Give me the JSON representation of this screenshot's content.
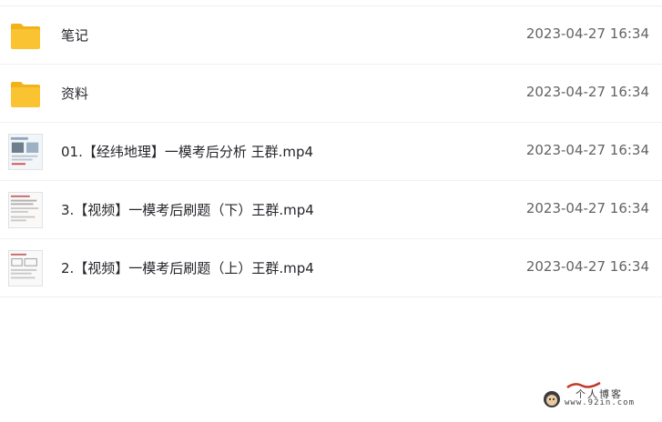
{
  "files": [
    {
      "type": "folder",
      "icon": "folder-icon",
      "name": "笔记",
      "date": "2023-04-27 16:34"
    },
    {
      "type": "folder",
      "icon": "folder-icon",
      "name": "资料",
      "date": "2023-04-27 16:34"
    },
    {
      "type": "video",
      "icon": "video-thumbnail-icon",
      "name": "01.【经纬地理】一模考后分析 王群.mp4",
      "date": "2023-04-27 16:34"
    },
    {
      "type": "video",
      "icon": "video-thumbnail-icon",
      "name": "3.【视频】一模考后刷题（下）王群.mp4",
      "date": "2023-04-27 16:34"
    },
    {
      "type": "video",
      "icon": "video-thumbnail-icon",
      "name": "2.【视频】一模考后刷题（上）王群.mp4",
      "date": "2023-04-27 16:34"
    }
  ],
  "watermark": {
    "title": "个人博客",
    "url": "www.92in.com"
  },
  "colors": {
    "folder": "#f9c332",
    "folder_tab": "#f2b31a",
    "border": "#f0f0f2",
    "text": "#25262b",
    "date": "#616366"
  }
}
